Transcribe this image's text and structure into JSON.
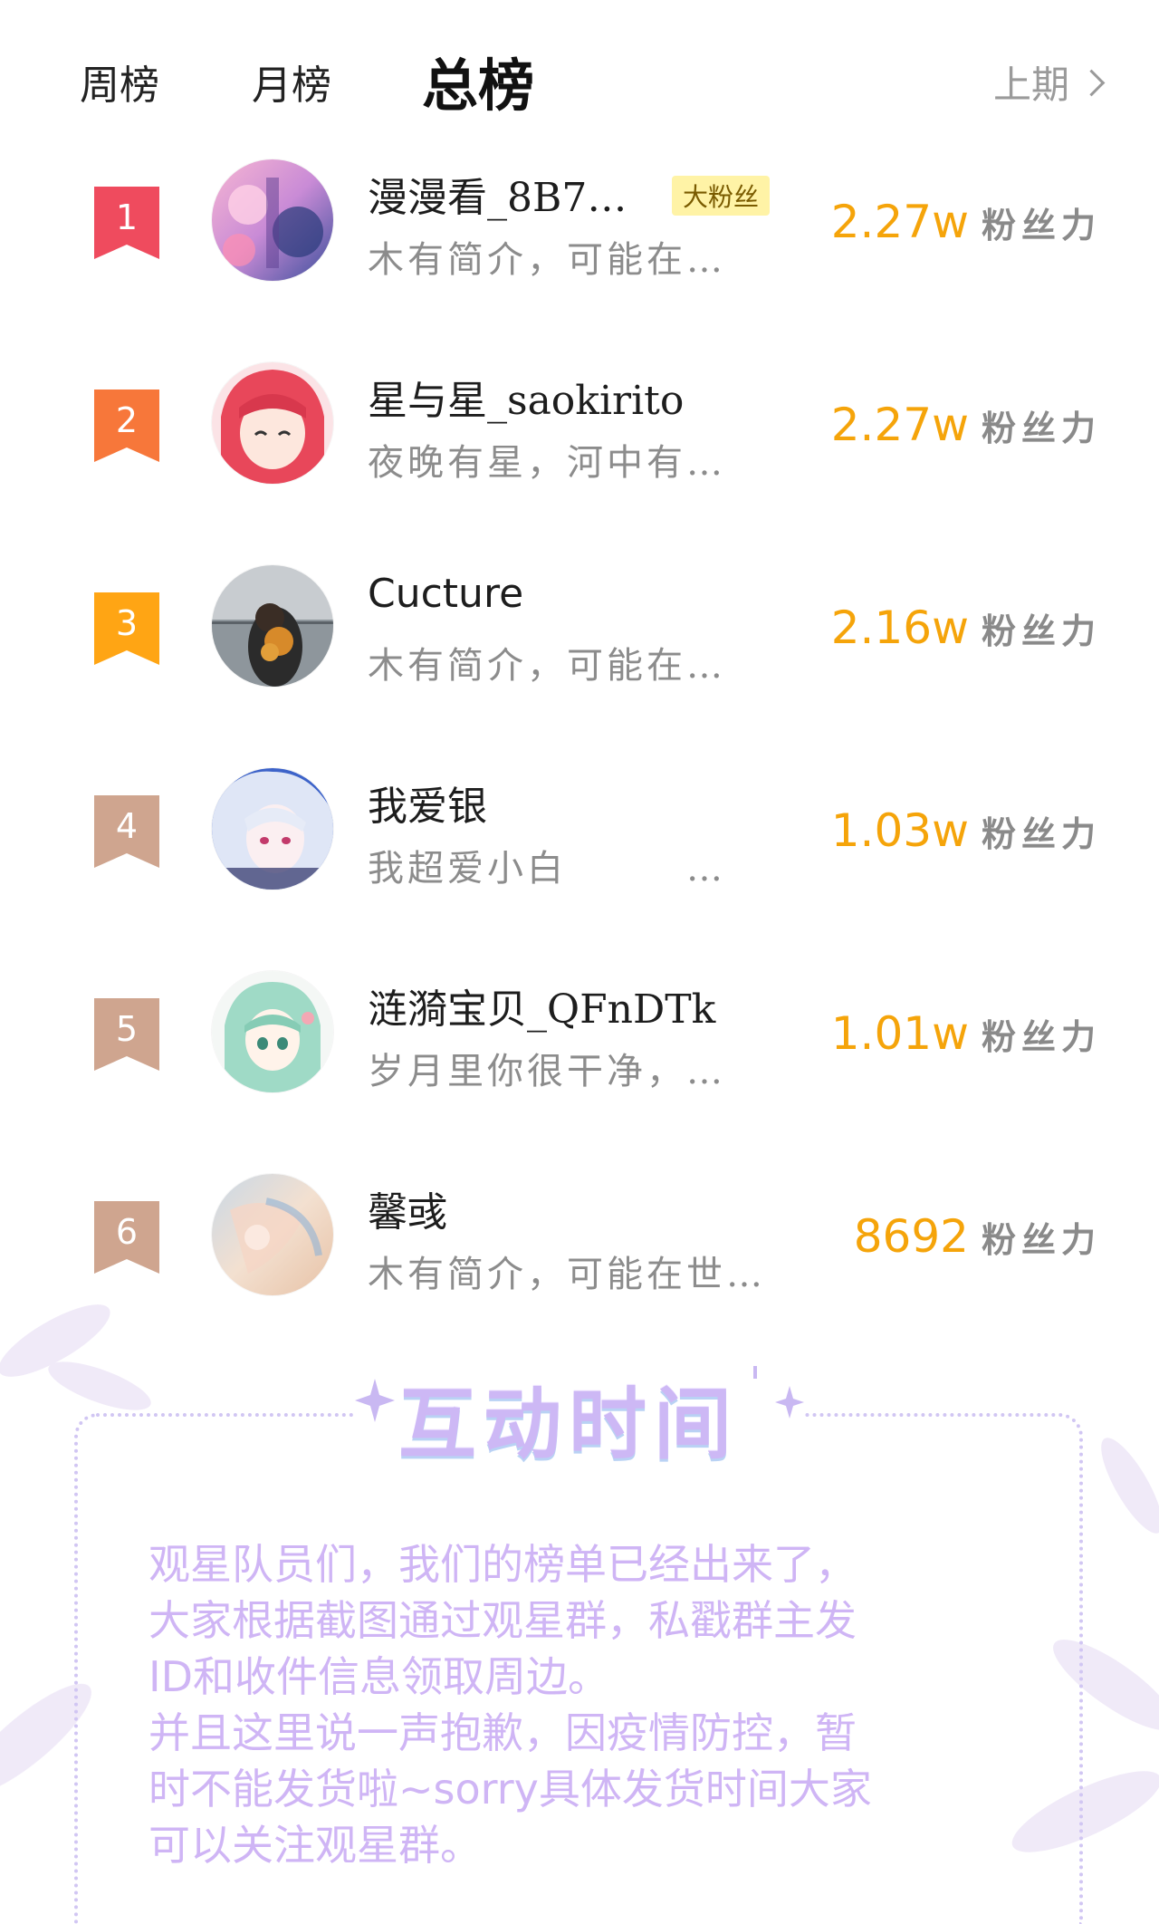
{
  "tabs": {
    "week": "周榜",
    "month": "月榜",
    "total": "总榜",
    "previous": "上期"
  },
  "ranking": [
    {
      "rank": "1",
      "badge_color": "#ef4b5e",
      "name": "漫漫看_8B7…",
      "tag": "大粉丝",
      "bio": "木有简介，可能在…",
      "score": "2.27w",
      "unit": "粉丝力"
    },
    {
      "rank": "2",
      "badge_color": "#f7773a",
      "name": "星与星_saokirito",
      "tag": "",
      "bio": "夜晚有星，河中有…",
      "score": "2.27w",
      "unit": "粉丝力"
    },
    {
      "rank": "3",
      "badge_color": "#ffa514",
      "name": "Cucture",
      "tag": "",
      "bio": "木有简介，可能在…",
      "score": "2.16w",
      "unit": "粉丝力"
    },
    {
      "rank": "4",
      "badge_color": "#cfa58f",
      "name": "我爱银",
      "tag": "",
      "bio": "我超爱小白　　　…",
      "score": "1.03w",
      "unit": "粉丝力"
    },
    {
      "rank": "5",
      "badge_color": "#cfa58f",
      "name": "涟漪宝贝_QFnDTk",
      "tag": "",
      "bio": "岁月里你很干净，…",
      "score": "1.01w",
      "unit": "粉丝力"
    },
    {
      "rank": "6",
      "badge_color": "#cfa58f",
      "name": "馨彧",
      "tag": "",
      "bio": "木有简介，可能在世…",
      "score": "8692",
      "unit": "粉丝力"
    }
  ],
  "interaction": {
    "title": "互动时间",
    "lines": [
      "观星队员们，我们的榜单已经出来了，",
      "大家根据截图通过观星群，私戳群主发",
      "ID和收件信息领取周边。",
      "并且这里说一声抱歉，因疫情防控，暂",
      "时不能发货啦~sorry具体发货时间大家",
      "可以关注观星群。"
    ]
  },
  "colors": {
    "score": "#f5a40a",
    "accent_purple": "#cfb5f5",
    "tag_bg": "#fff3a6"
  }
}
